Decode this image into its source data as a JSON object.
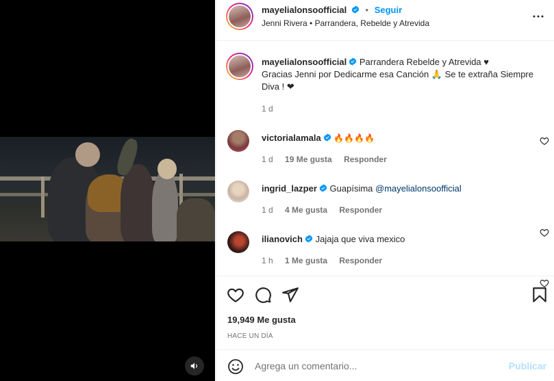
{
  "post": {
    "author": "mayelialonsoofficial",
    "separator": "•",
    "follow_label": "Seguir",
    "subtitle": "Jenni Rivera • Parrandera, Rebelde y Atrevida",
    "caption_line1": "Parrandera Rebelde y Atrevida ♥",
    "caption_line2": "Gracias Jenni por Dedicarme esa Canción 🙏 Se te extraña Siempre",
    "caption_line3": "Diva ! ❤",
    "caption_time": "1 d"
  },
  "comments": [
    {
      "user": "victorialamala",
      "text": "🔥🔥🔥🔥",
      "time": "1 d",
      "likes": "19 Me gusta",
      "reply": "Responder"
    },
    {
      "user": "ingrid_lazper",
      "text": "Guapísima ",
      "mention": "@mayelialonsoofficial",
      "time": "1 d",
      "likes": "4 Me gusta",
      "reply": "Responder"
    },
    {
      "user": "ilianovich",
      "text": "Jajaja que viva mexico",
      "time": "1 h",
      "likes": "1 Me gusta",
      "reply": "Responder"
    }
  ],
  "actions": {
    "like_count": "19,949 Me gusta",
    "time_ago": "HACE UN DÍA"
  },
  "add_comment": {
    "placeholder": "Agrega un comentario...",
    "publish_label": "Publicar"
  },
  "icons": {
    "verified": "verified-badge-icon",
    "more": "more-options-icon",
    "heart": "heart-icon",
    "comment": "comment-icon",
    "share": "share-icon",
    "save": "bookmark-icon",
    "emoji": "emoji-icon",
    "mute": "speaker-icon"
  },
  "colors": {
    "accent": "#0095f6",
    "verified": "#0095f6",
    "muted": "#737373",
    "publish_disabled": "#b2dffc"
  }
}
